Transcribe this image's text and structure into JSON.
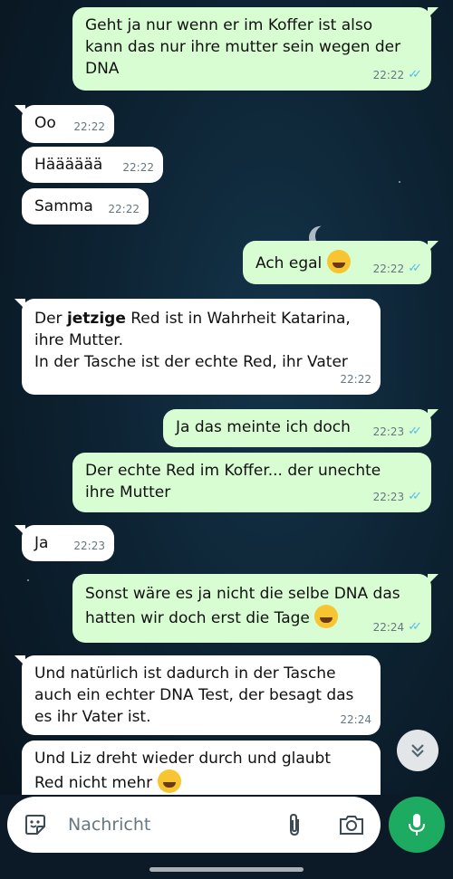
{
  "messages": [
    {
      "dir": "out",
      "text": "Geht ja nur wenn er im Koffer ist also\nkann das nur ihre mutter sein wegen der\nDNA",
      "time": "22:22",
      "read": true
    },
    {
      "dir": "in",
      "text": "Oo",
      "time": "22:22"
    },
    {
      "dir": "in",
      "text": "Hääääää",
      "time": "22:22"
    },
    {
      "dir": "in",
      "text": "Samma",
      "time": "22:22"
    },
    {
      "dir": "out",
      "text": "Ach egal",
      "emoji": "laughing-emoji",
      "time": "22:22",
      "read": true
    },
    {
      "dir": "in",
      "text_pre": "Der ",
      "text_bold": "jetzige",
      "text_post": " Red ist in Wahrheit Katarina,\nihre Mutter.\nIn der Tasche ist der echte Red, ihr Vater",
      "time": "22:22"
    },
    {
      "dir": "out",
      "text": "Ja das meinte ich doch",
      "time": "22:23",
      "read": true
    },
    {
      "dir": "out",
      "text": "Der echte Red im Koffer... der unechte\nihre Mutter",
      "time": "22:23",
      "read": true
    },
    {
      "dir": "in",
      "text": "Ja",
      "time": "22:23"
    },
    {
      "dir": "out",
      "text": "Sonst wäre es ja nicht die selbe DNA das\nhatten wir doch erst die Tage",
      "emoji": "laughing-emoji",
      "time": "22:24",
      "read": true
    },
    {
      "dir": "in",
      "text": "Und natürlich ist dadurch in der Tasche\nauch ein echter DNA Test, der besagt das\nes ihr Vater ist.",
      "time": "22:24"
    },
    {
      "dir": "in",
      "text": "Und Liz dreht wieder durch und glaubt\nRed nicht mehr",
      "emoji": "rolling-laughing-emoji",
      "time": ""
    }
  ],
  "composer": {
    "placeholder": "Nachricht"
  },
  "icons": {
    "sticker": "sticker-icon",
    "attach": "paperclip-icon",
    "camera": "camera-icon",
    "mic": "microphone-icon",
    "scroll": "double-chevron-down-icon"
  },
  "colors": {
    "outgoing": "#d9fdd3",
    "incoming": "#ffffff",
    "read_ticks": "#53bdeb",
    "mic_button": "#1daa61"
  }
}
